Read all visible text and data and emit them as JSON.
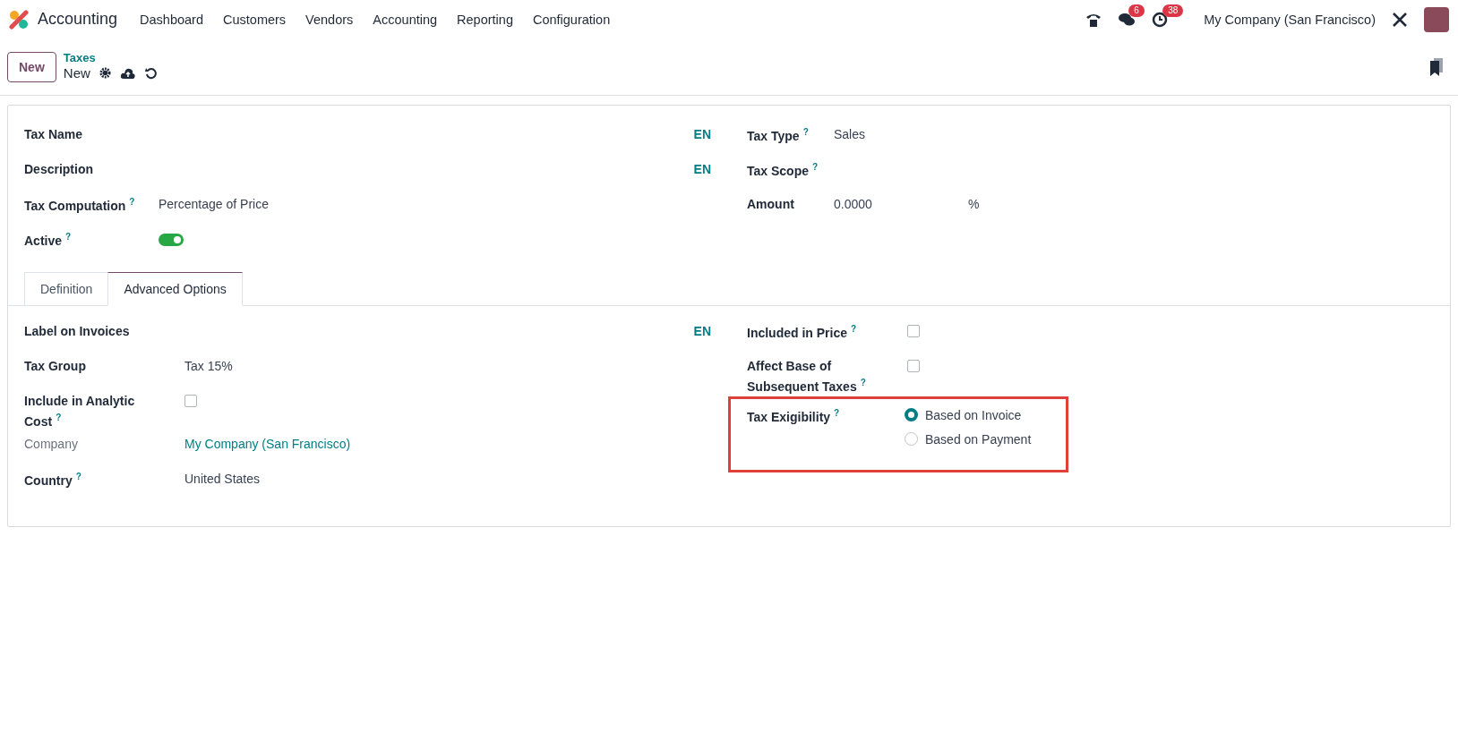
{
  "app": {
    "name": "Accounting"
  },
  "menu": [
    "Dashboard",
    "Customers",
    "Vendors",
    "Accounting",
    "Reporting",
    "Configuration"
  ],
  "systray": {
    "messages_badge": "6",
    "activities_badge": "38",
    "company": "My Company (San Francisco)"
  },
  "control_panel": {
    "new_button": "New",
    "breadcrumb": "Taxes",
    "record": "New"
  },
  "header_fields": {
    "left": [
      {
        "kind": "translatable",
        "label": "Tax Name",
        "lang": "EN"
      },
      {
        "kind": "translatable",
        "label": "Description",
        "lang": "EN"
      },
      {
        "kind": "value",
        "label": "Tax Computation",
        "help": "?",
        "value": "Percentage of Price"
      },
      {
        "kind": "toggle",
        "label": "Active",
        "help": "?",
        "on": true
      }
    ],
    "right": [
      {
        "kind": "value",
        "label": "Tax Type",
        "help": "?",
        "value": "Sales"
      },
      {
        "kind": "value",
        "label": "Tax Scope",
        "help": "?"
      },
      {
        "kind": "amount",
        "label": "Amount",
        "value": "0.0000",
        "unit": "%"
      }
    ]
  },
  "tabs": [
    {
      "label": "Definition",
      "selected": false
    },
    {
      "label": "Advanced Options",
      "selected": true
    }
  ],
  "advanced": {
    "left": [
      {
        "kind": "translatable",
        "label": "Label on Invoices",
        "lang": "EN"
      },
      {
        "kind": "value",
        "label": "Tax Group",
        "value": "Tax 15%"
      },
      {
        "kind": "checkbox",
        "label": "Include in Analytic Cost",
        "help": "?",
        "checked": false
      },
      {
        "kind": "link",
        "label": "Company",
        "value": "My Company (San Francisco)"
      },
      {
        "kind": "value",
        "label": "Country",
        "help": "?",
        "value": "United States"
      }
    ],
    "right": [
      {
        "kind": "checkbox",
        "label": "Included in Price",
        "help": "?",
        "checked": false
      },
      {
        "kind": "checkbox",
        "label": "Affect Base of Subsequent Taxes",
        "help": "?",
        "checked": false
      },
      {
        "kind": "radio",
        "label": "Tax Exigibility",
        "help": "?",
        "highlighted": true,
        "options": [
          {
            "label": "Based on Invoice",
            "selected": true
          },
          {
            "label": "Based on Payment",
            "selected": false
          }
        ]
      }
    ]
  }
}
